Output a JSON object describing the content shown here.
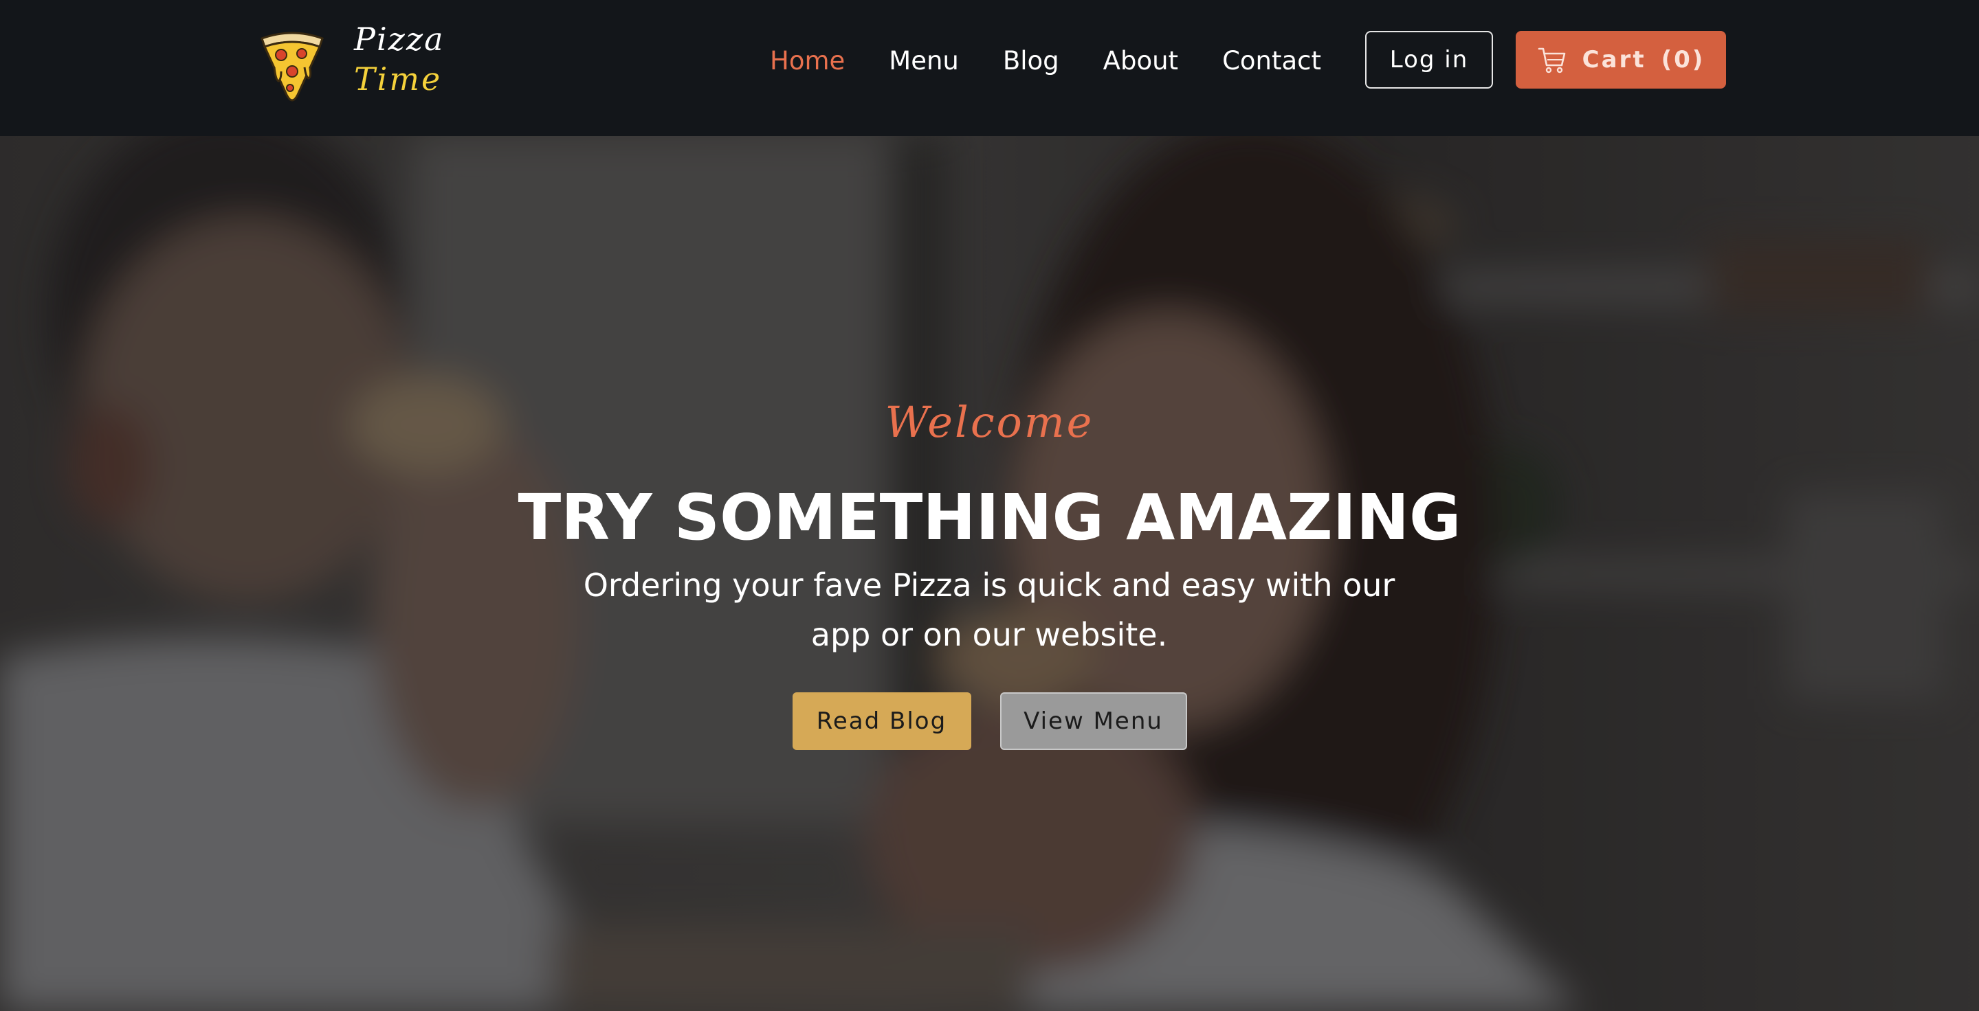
{
  "brand": {
    "line1": "Pizza",
    "line2": "Time",
    "logo_icon": "pizza-slice-icon",
    "accent_yellow": "#f4d13b"
  },
  "nav": {
    "items": [
      {
        "label": "Home",
        "active": true
      },
      {
        "label": "Menu",
        "active": false
      },
      {
        "label": "Blog",
        "active": false
      },
      {
        "label": "About",
        "active": false
      },
      {
        "label": "Contact",
        "active": false
      }
    ],
    "login_label": "Log in",
    "cart_label": "Cart",
    "cart_count": "(0)",
    "cart_icon": "shopping-cart-icon"
  },
  "hero": {
    "welcome": "Welcome",
    "headline": "TRY SOMETHING AMAZING",
    "subtext": "Ordering your fave Pizza is quick and easy with our app or on our website.",
    "buttons": {
      "read_blog": "Read Blog",
      "view_menu": "View Menu"
    }
  },
  "colors": {
    "header_bg": "#13161a",
    "accent_orange": "#e9714e",
    "cart_bg": "#d4603f",
    "read_blog_bg": "#d6a956",
    "view_menu_bg": "#9a9a9a"
  }
}
